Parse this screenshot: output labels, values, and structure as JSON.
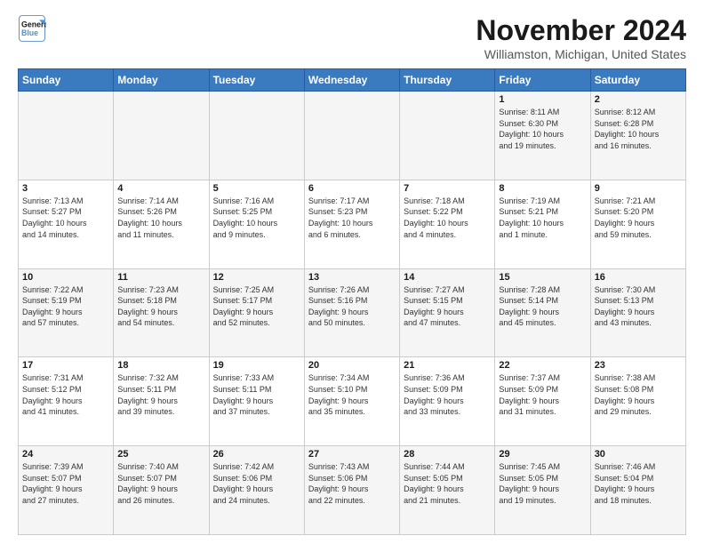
{
  "logo": {
    "line1": "General",
    "line2": "Blue"
  },
  "header": {
    "month": "November 2024",
    "location": "Williamston, Michigan, United States"
  },
  "weekdays": [
    "Sunday",
    "Monday",
    "Tuesday",
    "Wednesday",
    "Thursday",
    "Friday",
    "Saturday"
  ],
  "weeks": [
    [
      {
        "day": "",
        "detail": ""
      },
      {
        "day": "",
        "detail": ""
      },
      {
        "day": "",
        "detail": ""
      },
      {
        "day": "",
        "detail": ""
      },
      {
        "day": "",
        "detail": ""
      },
      {
        "day": "1",
        "detail": "Sunrise: 8:11 AM\nSunset: 6:30 PM\nDaylight: 10 hours\nand 19 minutes."
      },
      {
        "day": "2",
        "detail": "Sunrise: 8:12 AM\nSunset: 6:28 PM\nDaylight: 10 hours\nand 16 minutes."
      }
    ],
    [
      {
        "day": "3",
        "detail": "Sunrise: 7:13 AM\nSunset: 5:27 PM\nDaylight: 10 hours\nand 14 minutes."
      },
      {
        "day": "4",
        "detail": "Sunrise: 7:14 AM\nSunset: 5:26 PM\nDaylight: 10 hours\nand 11 minutes."
      },
      {
        "day": "5",
        "detail": "Sunrise: 7:16 AM\nSunset: 5:25 PM\nDaylight: 10 hours\nand 9 minutes."
      },
      {
        "day": "6",
        "detail": "Sunrise: 7:17 AM\nSunset: 5:23 PM\nDaylight: 10 hours\nand 6 minutes."
      },
      {
        "day": "7",
        "detail": "Sunrise: 7:18 AM\nSunset: 5:22 PM\nDaylight: 10 hours\nand 4 minutes."
      },
      {
        "day": "8",
        "detail": "Sunrise: 7:19 AM\nSunset: 5:21 PM\nDaylight: 10 hours\nand 1 minute."
      },
      {
        "day": "9",
        "detail": "Sunrise: 7:21 AM\nSunset: 5:20 PM\nDaylight: 9 hours\nand 59 minutes."
      }
    ],
    [
      {
        "day": "10",
        "detail": "Sunrise: 7:22 AM\nSunset: 5:19 PM\nDaylight: 9 hours\nand 57 minutes."
      },
      {
        "day": "11",
        "detail": "Sunrise: 7:23 AM\nSunset: 5:18 PM\nDaylight: 9 hours\nand 54 minutes."
      },
      {
        "day": "12",
        "detail": "Sunrise: 7:25 AM\nSunset: 5:17 PM\nDaylight: 9 hours\nand 52 minutes."
      },
      {
        "day": "13",
        "detail": "Sunrise: 7:26 AM\nSunset: 5:16 PM\nDaylight: 9 hours\nand 50 minutes."
      },
      {
        "day": "14",
        "detail": "Sunrise: 7:27 AM\nSunset: 5:15 PM\nDaylight: 9 hours\nand 47 minutes."
      },
      {
        "day": "15",
        "detail": "Sunrise: 7:28 AM\nSunset: 5:14 PM\nDaylight: 9 hours\nand 45 minutes."
      },
      {
        "day": "16",
        "detail": "Sunrise: 7:30 AM\nSunset: 5:13 PM\nDaylight: 9 hours\nand 43 minutes."
      }
    ],
    [
      {
        "day": "17",
        "detail": "Sunrise: 7:31 AM\nSunset: 5:12 PM\nDaylight: 9 hours\nand 41 minutes."
      },
      {
        "day": "18",
        "detail": "Sunrise: 7:32 AM\nSunset: 5:11 PM\nDaylight: 9 hours\nand 39 minutes."
      },
      {
        "day": "19",
        "detail": "Sunrise: 7:33 AM\nSunset: 5:11 PM\nDaylight: 9 hours\nand 37 minutes."
      },
      {
        "day": "20",
        "detail": "Sunrise: 7:34 AM\nSunset: 5:10 PM\nDaylight: 9 hours\nand 35 minutes."
      },
      {
        "day": "21",
        "detail": "Sunrise: 7:36 AM\nSunset: 5:09 PM\nDaylight: 9 hours\nand 33 minutes."
      },
      {
        "day": "22",
        "detail": "Sunrise: 7:37 AM\nSunset: 5:09 PM\nDaylight: 9 hours\nand 31 minutes."
      },
      {
        "day": "23",
        "detail": "Sunrise: 7:38 AM\nSunset: 5:08 PM\nDaylight: 9 hours\nand 29 minutes."
      }
    ],
    [
      {
        "day": "24",
        "detail": "Sunrise: 7:39 AM\nSunset: 5:07 PM\nDaylight: 9 hours\nand 27 minutes."
      },
      {
        "day": "25",
        "detail": "Sunrise: 7:40 AM\nSunset: 5:07 PM\nDaylight: 9 hours\nand 26 minutes."
      },
      {
        "day": "26",
        "detail": "Sunrise: 7:42 AM\nSunset: 5:06 PM\nDaylight: 9 hours\nand 24 minutes."
      },
      {
        "day": "27",
        "detail": "Sunrise: 7:43 AM\nSunset: 5:06 PM\nDaylight: 9 hours\nand 22 minutes."
      },
      {
        "day": "28",
        "detail": "Sunrise: 7:44 AM\nSunset: 5:05 PM\nDaylight: 9 hours\nand 21 minutes."
      },
      {
        "day": "29",
        "detail": "Sunrise: 7:45 AM\nSunset: 5:05 PM\nDaylight: 9 hours\nand 19 minutes."
      },
      {
        "day": "30",
        "detail": "Sunrise: 7:46 AM\nSunset: 5:04 PM\nDaylight: 9 hours\nand 18 minutes."
      }
    ]
  ]
}
